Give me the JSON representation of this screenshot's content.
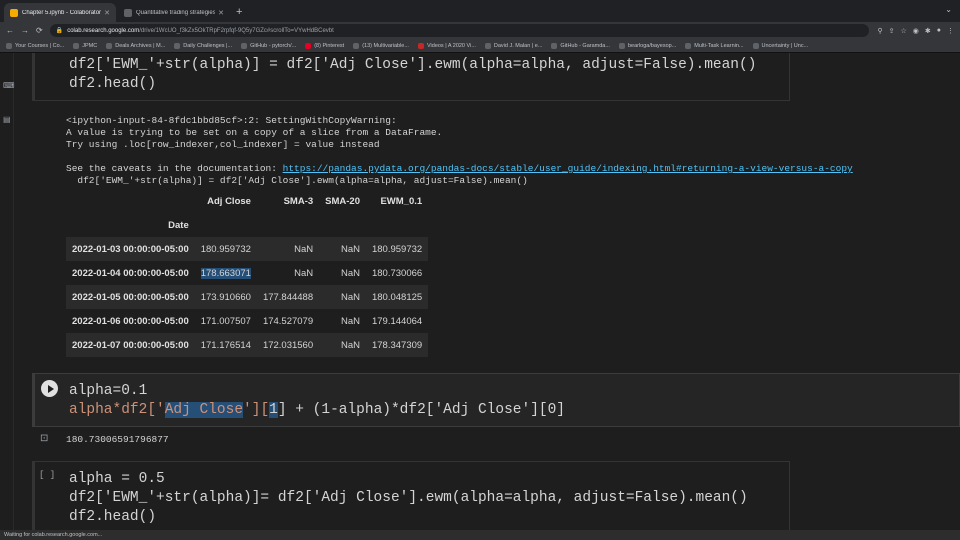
{
  "browser": {
    "tabs": [
      {
        "label": "Chapter 5.ipynb - Colaborator",
        "active": true,
        "favicon_color": "#f9ab00"
      },
      {
        "label": "Quantitative trading strategies",
        "active": false,
        "favicon_color": "#5f6368"
      }
    ],
    "new_tab": "+",
    "url_host": "colab.research.google.com",
    "url_rest": "/drive/1WcUO_f3kZx5OkTRpF2rpfqf-9Q5y7GZc#scrollTo=VYwHdBCevbt",
    "bookmarks": [
      "Your Courses | Co...",
      "JPMC",
      "Deals Archives | M...",
      "Daily Challenges |...",
      "GitHub - pytorch/...",
      "(8) Pinterest",
      "(13) Multivariable...",
      "Videos | A 2020 Vi...",
      "David J. Malan | e...",
      "GitHub - Garamda...",
      "bearloga/bayesop...",
      "Multi-Task Learnin...",
      "Uncertainty | Unc..."
    ]
  },
  "cell1": {
    "line1": "df2['EWM_'+str(alpha)] = df2['Adj Close'].ewm(alpha=alpha, adjust=False).mean()",
    "line2": "df2.head()"
  },
  "cell1_output": {
    "warning_l1": "<ipython-input-84-8fdc1bbd85cf>:2: SettingWithCopyWarning:",
    "warning_l2": "A value is trying to be set on a copy of a slice from a DataFrame.",
    "warning_l3": "Try using .loc[row_indexer,col_indexer] = value instead",
    "caveat_prefix": "See the caveats in the documentation: ",
    "caveat_link": "https://pandas.pydata.org/pandas-docs/stable/user_guide/indexing.html#returning-a-view-versus-a-copy",
    "warning_l5": "  df2['EWM_'+str(alpha)] = df2['Adj Close'].ewm(alpha=alpha, adjust=False).mean()",
    "table": {
      "columns": [
        "Adj Close",
        "SMA-3",
        "SMA-20",
        "EWM_0.1"
      ],
      "index_name": "Date",
      "rows": [
        {
          "date": "2022-01-03 00:00:00-05:00",
          "values": [
            "180.959732",
            "NaN",
            "NaN",
            "180.959732"
          ]
        },
        {
          "date": "2022-01-04 00:00:00-05:00",
          "values": [
            "178.663071",
            "NaN",
            "NaN",
            "180.730066"
          ]
        },
        {
          "date": "2022-01-05 00:00:00-05:00",
          "values": [
            "173.910660",
            "177.844488",
            "NaN",
            "180.048125"
          ]
        },
        {
          "date": "2022-01-06 00:00:00-05:00",
          "values": [
            "171.007507",
            "174.527079",
            "NaN",
            "179.144064"
          ]
        },
        {
          "date": "2022-01-07 00:00:00-05:00",
          "values": [
            "171.176514",
            "172.031560",
            "NaN",
            "178.347309"
          ]
        }
      ]
    }
  },
  "cell2": {
    "line1": "alpha=0.1",
    "line2_a": "alpha*df2['",
    "line2_sel": "Adj Close",
    "line2_b": "'][",
    "line2_idx": "1",
    "line2_c": "] + (1-alpha)*df2['Adj Close'][0]",
    "output": "180.73006591796877"
  },
  "cell3": {
    "bracket": "[ ]",
    "line1": "alpha = 0.5",
    "line2": "df2['EWM_'+str(alpha)]= df2['Adj Close'].ewm(alpha=alpha, adjust=False).mean()",
    "line3": "df2.head()"
  },
  "status": "Waiting for colab.research.google.com..."
}
